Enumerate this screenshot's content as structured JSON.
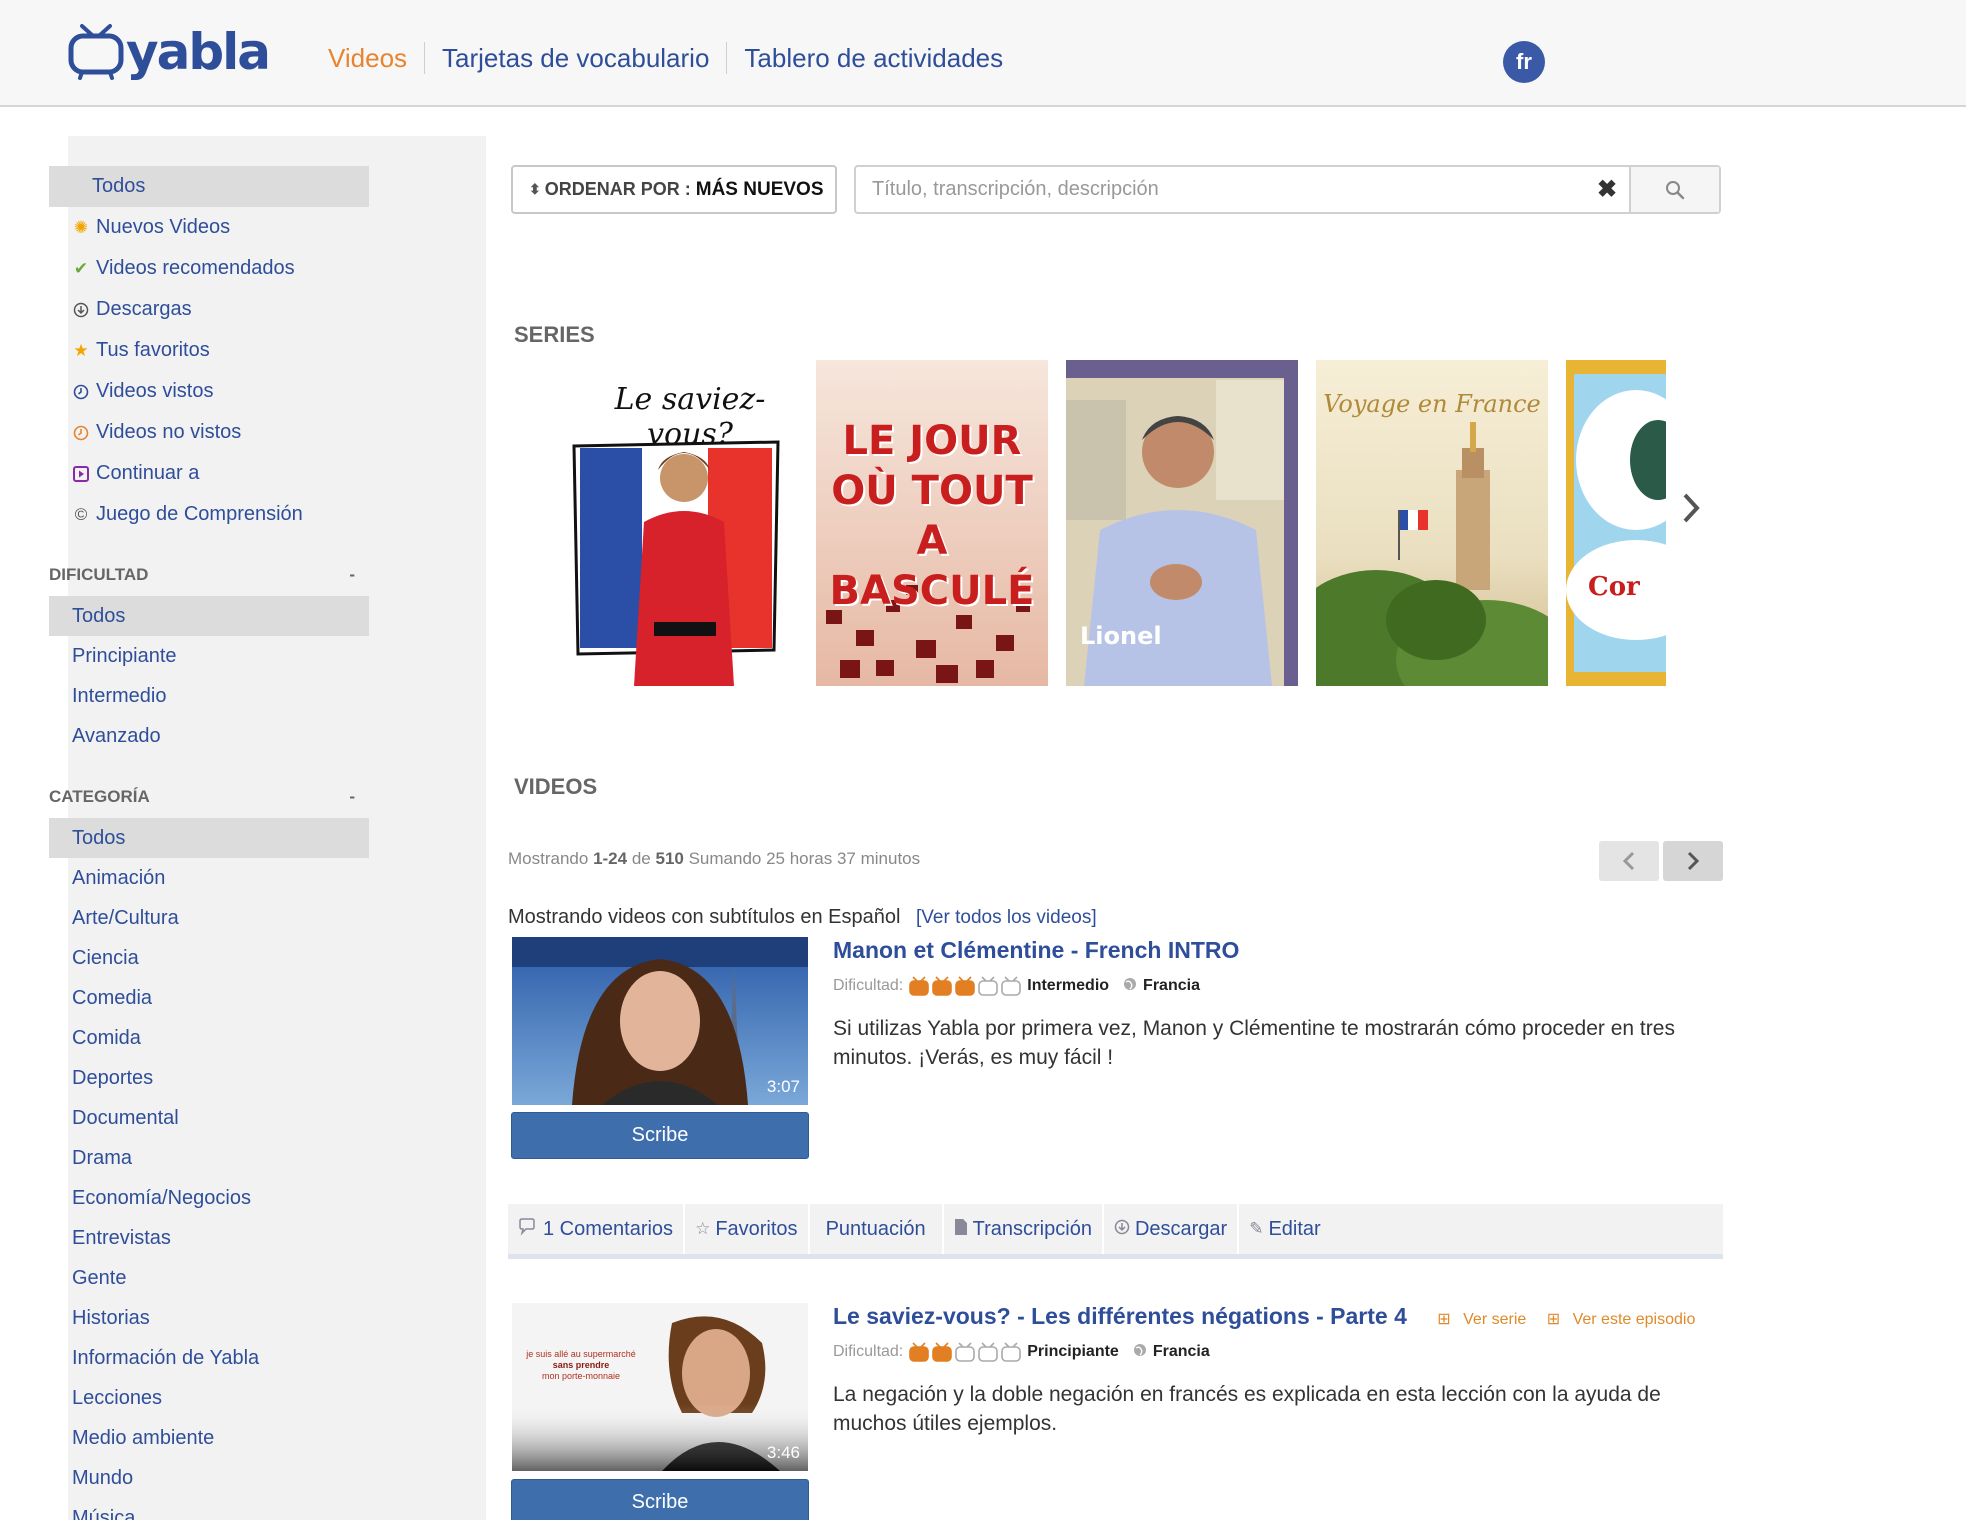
{
  "header": {
    "logo": "yabla",
    "nav": [
      "Videos",
      "Tarjetas de vocabulario",
      "Tablero de actividades"
    ],
    "language_badge": "fr"
  },
  "sidebar": {
    "quick": [
      {
        "label": "Todos",
        "icon": "none",
        "selected": true
      },
      {
        "label": "Nuevos Videos",
        "icon": "sun-icon",
        "color": "#f2a500"
      },
      {
        "label": "Videos recomendados",
        "icon": "check-icon",
        "color": "#6aaa3a"
      },
      {
        "label": "Descargas",
        "icon": "download-icon",
        "color": "#666666"
      },
      {
        "label": "Tus favoritos",
        "icon": "star-icon",
        "color": "#f2a500"
      },
      {
        "label": "Videos vistos",
        "icon": "clock-icon",
        "color": "#2f4e9a"
      },
      {
        "label": "Videos no vistos",
        "icon": "clock-icon",
        "color": "#e8842f"
      },
      {
        "label": "Continuar a",
        "icon": "play-icon",
        "color": "#8a2aa8"
      },
      {
        "label": "Juego de Comprensión",
        "icon": "copyright-icon",
        "color": "#555555"
      }
    ],
    "difficulty": {
      "title": "DIFICULTAD",
      "toggle": "-",
      "items": [
        "Todos",
        "Principiante",
        "Intermedio",
        "Avanzado"
      ]
    },
    "category": {
      "title": "CATEGORÍA",
      "toggle": "-",
      "items": [
        "Todos",
        "Animación",
        "Arte/Cultura",
        "Ciencia",
        "Comedia",
        "Comida",
        "Deportes",
        "Documental",
        "Drama",
        "Economía/Negocios",
        "Entrevistas",
        "Gente",
        "Historias",
        "Información de Yabla",
        "Lecciones",
        "Medio ambiente",
        "Mundo",
        "Música"
      ]
    }
  },
  "sort": {
    "label": "ORDENAR POR :",
    "value": "MÁS NUEVOS"
  },
  "search": {
    "placeholder": "Título, transcripción, descripción",
    "value": ""
  },
  "series": {
    "title": "SERIES",
    "cards": [
      {
        "name": "Le saviez-vous?",
        "text": "Le saviez-vous?"
      },
      {
        "name": "Le jour où tout a basculé",
        "text": "LE JOUR OÙ TOUT A BASCULÉ"
      },
      {
        "name": "Lionel",
        "text": "Lionel"
      },
      {
        "name": "Voyage en France",
        "text": "Voyage en France"
      },
      {
        "name": "Cor",
        "text": "Cor"
      }
    ]
  },
  "videos": {
    "title": "VIDEOS",
    "showing": {
      "prefix": "Mostrando",
      "range": "1-24",
      "of": "de",
      "total": "510",
      "sum": "Sumando 25 horas 37 minutos"
    },
    "subtitle_note": "Mostrando videos con subtítulos en Español",
    "see_all": "[Ver todos los videos]",
    "difficulty_label": "Dificultad:",
    "scribe_label": "Scribe",
    "items": [
      {
        "title": "Manon et Clémentine - French INTRO",
        "level": "Intermedio",
        "level_value": 3,
        "country": "Francia",
        "duration": "3:07",
        "description": "Si utilizas Yabla por primera vez, Manon y Clémentine te mostrarán cómo proceder en tres minutos. ¡Verás, es muy fácil !"
      },
      {
        "title": "Le saviez-vous? - Les différentes négations - Parte 4",
        "series_link": "Ver serie",
        "episode_link": "Ver este episodio",
        "level": "Principiante",
        "level_value": 2,
        "country": "Francia",
        "duration": "3:46",
        "thumb_text": [
          "je suis allé au supermarché",
          "sans prendre",
          "mon porte-monnaie"
        ],
        "description": "La negación y la doble negación en francés es explicada en esta lección con la ayuda de muchos útiles ejemplos."
      }
    ],
    "actions": [
      "1 Comentarios",
      "Favoritos",
      "Puntuación",
      "Transcripción",
      "Descargar",
      "Editar"
    ]
  }
}
